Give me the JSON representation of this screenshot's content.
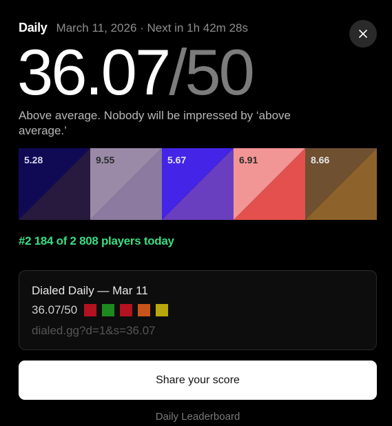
{
  "header": {
    "mode": "Daily",
    "meta": "March 11, 2026 · Next in 1h 42m 28s"
  },
  "icons": {
    "close": "close-icon"
  },
  "score": {
    "value": "36.07",
    "max": "/50"
  },
  "comment": "Above average. Nobody will be impressed by ‘above average.’",
  "swatches": [
    {
      "score": "5.28",
      "target_color": "#100a55",
      "guess_color": "#281a3f",
      "text_color": "#d8d8e8"
    },
    {
      "score": "9.55",
      "target_color": "#9a8aa8",
      "guess_color": "#8c7aa0",
      "text_color": "#2a2a2a"
    },
    {
      "score": "5.67",
      "target_color": "#4424e6",
      "guess_color": "#6a3fbf",
      "text_color": "#e6e6f2"
    },
    {
      "score": "6.91",
      "target_color": "#f29695",
      "guess_color": "#e4504e",
      "text_color": "#2a2a2a"
    },
    {
      "score": "8.66",
      "target_color": "#6f5030",
      "guess_color": "#8e632b",
      "text_color": "#e6e6e6"
    }
  ],
  "rank": "#2 184 of 2 808 players today",
  "share_card": {
    "title": "Dialed Daily — Mar 11",
    "score": "36.07/50",
    "squares": [
      "#b3121f",
      "#1e8a1e",
      "#b3121f",
      "#c9541a",
      "#b8a60d"
    ],
    "link": "dialed.gg?d=1&s=36.07"
  },
  "share_button": "Share your score",
  "leaderboard_link": "Daily Leaderboard"
}
